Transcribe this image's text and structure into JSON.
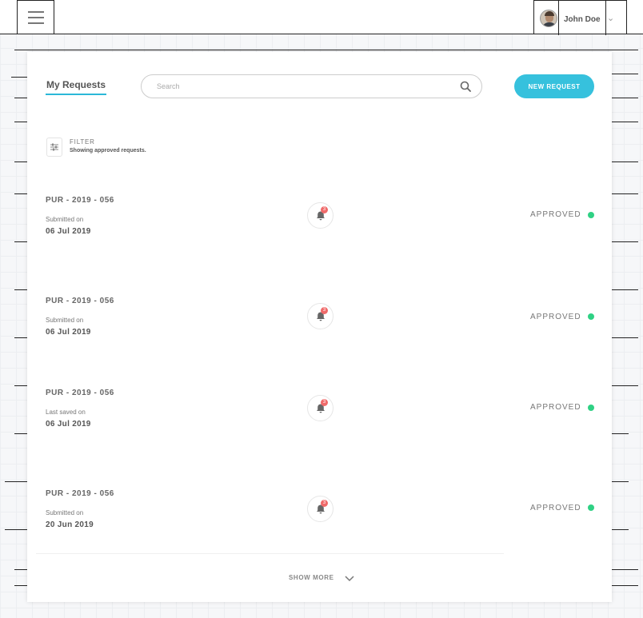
{
  "topbar": {
    "user_name": "John Doe"
  },
  "toolbar": {
    "tab_label": "My Requests",
    "search_placeholder": "Search",
    "new_request_label": "NEW REQUEST"
  },
  "filter": {
    "title": "FILTER",
    "subtitle": "Showing approved requests."
  },
  "requests": [
    {
      "id": "PUR - 2019 - 056",
      "label": "Submitted on",
      "date": "06 Jul 2019",
      "badge": "3",
      "status": "APPROVED"
    },
    {
      "id": "PUR - 2019 - 056",
      "label": "Submitted on",
      "date": "06 Jul 2019",
      "badge": "3",
      "status": "APPROVED"
    },
    {
      "id": "PUR - 2019 - 056",
      "label": "Last saved on",
      "date": "06 Jul 2019",
      "badge": "3",
      "status": "APPROVED"
    },
    {
      "id": "PUR - 2019 - 056",
      "label": "Submitted on",
      "date": "20 Jun 2019",
      "badge": "3",
      "status": "APPROVED"
    }
  ],
  "footer": {
    "show_more_label": "SHOW MORE"
  },
  "colors": {
    "accent": "#36c1dd",
    "tab_underline": "#2bb8d8",
    "status_approved": "#2fd184",
    "notification_badge": "#f06a6a"
  }
}
